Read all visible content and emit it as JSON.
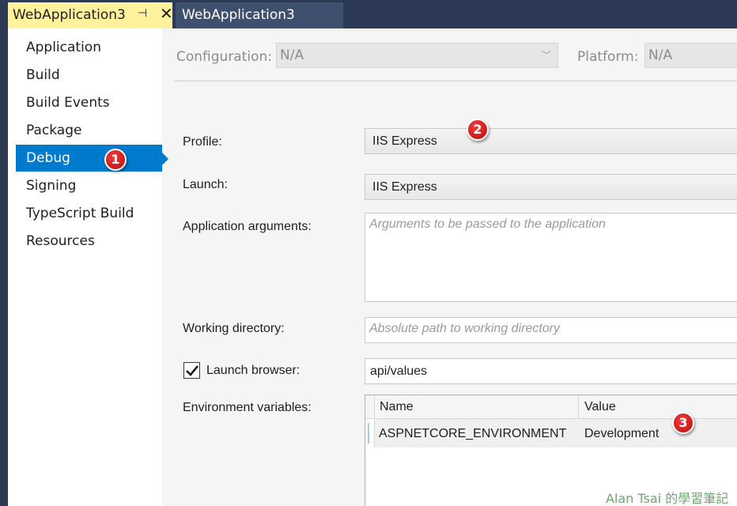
{
  "tabs": {
    "active": {
      "title": "WebApplication3",
      "pin_icon": "pin-icon",
      "close_icon": "close-icon"
    },
    "inactive": {
      "title": "WebApplication3"
    }
  },
  "sidebar": {
    "items": [
      {
        "label": "Application"
      },
      {
        "label": "Build"
      },
      {
        "label": "Build Events"
      },
      {
        "label": "Package"
      },
      {
        "label": "Debug",
        "selected": true
      },
      {
        "label": "Signing"
      },
      {
        "label": "TypeScript Build"
      },
      {
        "label": "Resources"
      }
    ]
  },
  "config": {
    "configuration_label": "Configuration:",
    "configuration_value": "N/A",
    "platform_label": "Platform:",
    "platform_value": "N/A"
  },
  "form": {
    "profile_label": "Profile:",
    "profile_value": "IIS Express",
    "launch_label": "Launch:",
    "launch_value": "IIS Express",
    "args_label": "Application arguments:",
    "args_placeholder": "Arguments to be passed to the application",
    "workdir_label": "Working directory:",
    "workdir_placeholder": "Absolute path to working directory",
    "launch_browser_label": "Launch browser:",
    "launch_browser_checked": true,
    "launch_browser_value": "api/values",
    "env_label": "Environment variables:",
    "env_columns": [
      "Name",
      "Value"
    ],
    "env_rows": [
      {
        "name": "ASPNETCORE_ENVIRONMENT",
        "value": "Development"
      }
    ]
  },
  "annotations": {
    "badge1": "1",
    "badge2": "2",
    "badge3": "3",
    "badge_color": "#d01818"
  },
  "watermark": "Alan Tsai 的學習筆記",
  "colors": {
    "accent": "#007acc",
    "active_tab": "#fff29d",
    "chrome": "#2d3a56"
  }
}
